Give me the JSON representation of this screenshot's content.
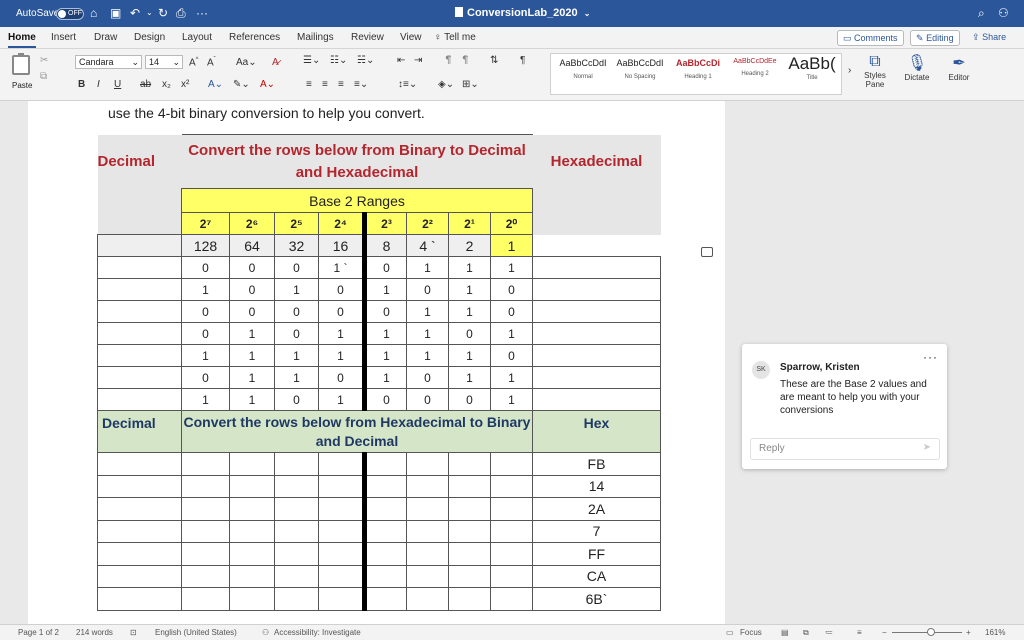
{
  "titlebar": {
    "autosave_label": "AutoSave",
    "autosave_state": "OFF",
    "doc_title": "ConversionLab_2020",
    "more": "···"
  },
  "tabs": [
    "Home",
    "Insert",
    "Draw",
    "Design",
    "Layout",
    "References",
    "Mailings",
    "Review",
    "View"
  ],
  "tell_me": "Tell me",
  "ribbon_buttons": {
    "comments": "Comments",
    "editing": "Editing",
    "share": "Share"
  },
  "ribbon": {
    "paste": "Paste",
    "font_name": "Candara",
    "font_size": "14",
    "styles": [
      {
        "preview": "AaBbCcDdI",
        "name": "Normal"
      },
      {
        "preview": "AaBbCcDdI",
        "name": "No Spacing"
      },
      {
        "preview": "AaBbCcDi",
        "name": "Heading 1"
      },
      {
        "preview": "AaBbCcDdEe",
        "name": "Heading 2"
      },
      {
        "preview": "AaBb(",
        "name": "Title"
      }
    ],
    "styles_pane": "Styles\nPane",
    "dictate": "Dictate",
    "editor": "Editor"
  },
  "document": {
    "intro": "use the 4-bit binary conversion to help you convert.",
    "section1": {
      "left_header": "Decimal",
      "center_header": "Convert the rows below from Binary to Decimal and Hexadecimal",
      "right_header": "Hexadecimal",
      "ranges_title": "Base 2 Ranges",
      "powers": [
        "2⁷",
        "2⁶",
        "2⁵",
        "2⁴",
        "2³",
        "2²",
        "2¹",
        "2⁰"
      ],
      "values": [
        "128",
        "64",
        "32",
        "16",
        "8",
        "4 `",
        "2",
        "1"
      ],
      "rows": [
        [
          "0",
          "0",
          "0",
          "1 `",
          "0",
          "1",
          "1",
          "1"
        ],
        [
          "1",
          "0",
          "1",
          "0",
          "1",
          "0",
          "1",
          "0"
        ],
        [
          "0",
          "0",
          "0",
          "0",
          "0",
          "1",
          "1",
          "0"
        ],
        [
          "0",
          "1",
          "0",
          "1",
          "1",
          "1",
          "0",
          "1"
        ],
        [
          "1",
          "1",
          "1",
          "1",
          "1",
          "1",
          "1",
          "0"
        ],
        [
          "0",
          "1",
          "1",
          "0",
          "1",
          "0",
          "1",
          "1"
        ],
        [
          "1",
          "1",
          "0",
          "1",
          "0",
          "0",
          "0",
          "1"
        ]
      ]
    },
    "section2": {
      "left_header": "Decimal",
      "center_header": "Convert the rows below from Hexadecimal to Binary and Decimal",
      "right_header": "Hex",
      "hex_values": [
        "FB",
        "14",
        "2A",
        "7",
        "FF",
        "CA",
        "6B`"
      ]
    }
  },
  "comment": {
    "initials": "SK",
    "author": "Sparrow, Kristen",
    "text": "These are the Base 2 values and are meant to help you with your conversions",
    "reply_placeholder": "Reply",
    "more": "···"
  },
  "statusbar": {
    "page": "Page 1 of 2",
    "words": "214 words",
    "language": "English (United States)",
    "accessibility": "Accessibility: Investigate",
    "focus": "Focus",
    "zoom": "161%",
    "zoom_minus": "−",
    "zoom_plus": "+"
  }
}
